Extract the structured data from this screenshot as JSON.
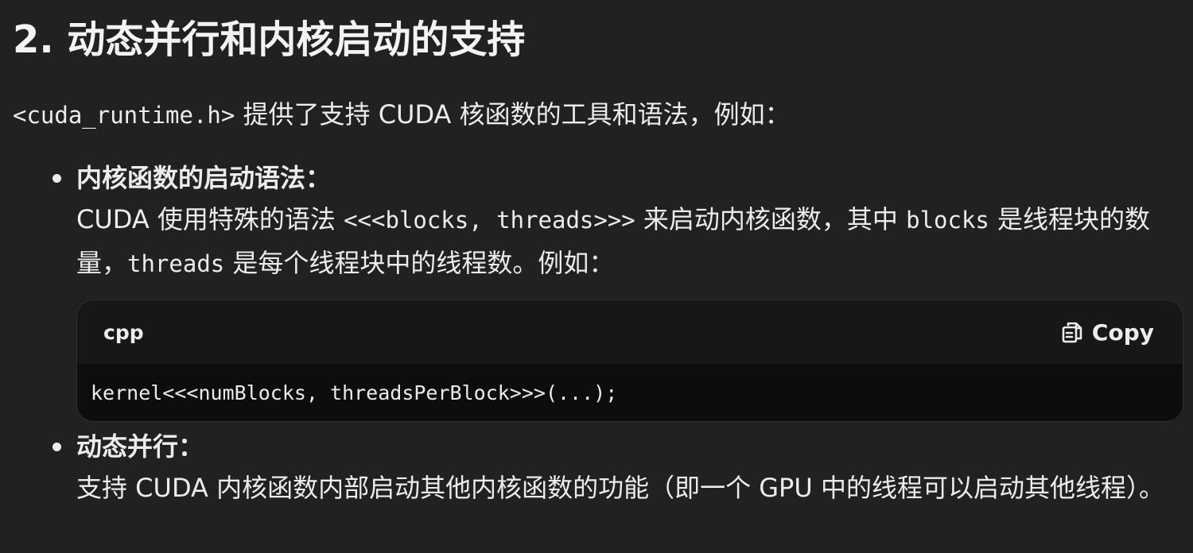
{
  "heading": "2. 动态并行和内核启动的支持",
  "intro": {
    "code": "<cuda_runtime.h>",
    "text": " 提供了支持 CUDA 核函数的工具和语法，例如："
  },
  "items": [
    {
      "title": "内核函数的启动语法：",
      "body": [
        {
          "text": "CUDA 使用特殊的语法 "
        },
        {
          "code": "<<<blocks, threads>>>"
        },
        {
          "text": " 来启动内核函数，其中 "
        },
        {
          "code": "blocks"
        },
        {
          "text": " 是线程块的数量，"
        },
        {
          "code": "threads"
        },
        {
          "text": " 是每个线程块中的线程数。例如："
        }
      ]
    },
    {
      "title": "动态并行：",
      "body": [
        {
          "text": "支持 CUDA 内核函数内部启动其他内核函数的功能（即一个 GPU 中的线程可以启动其他线程）。"
        }
      ]
    }
  ],
  "code_block": {
    "language": "cpp",
    "copy_label": "Copy",
    "copy_icon": "copy-icon",
    "code": "kernel<<<numBlocks, threadsPerBlock>>>(...);"
  }
}
